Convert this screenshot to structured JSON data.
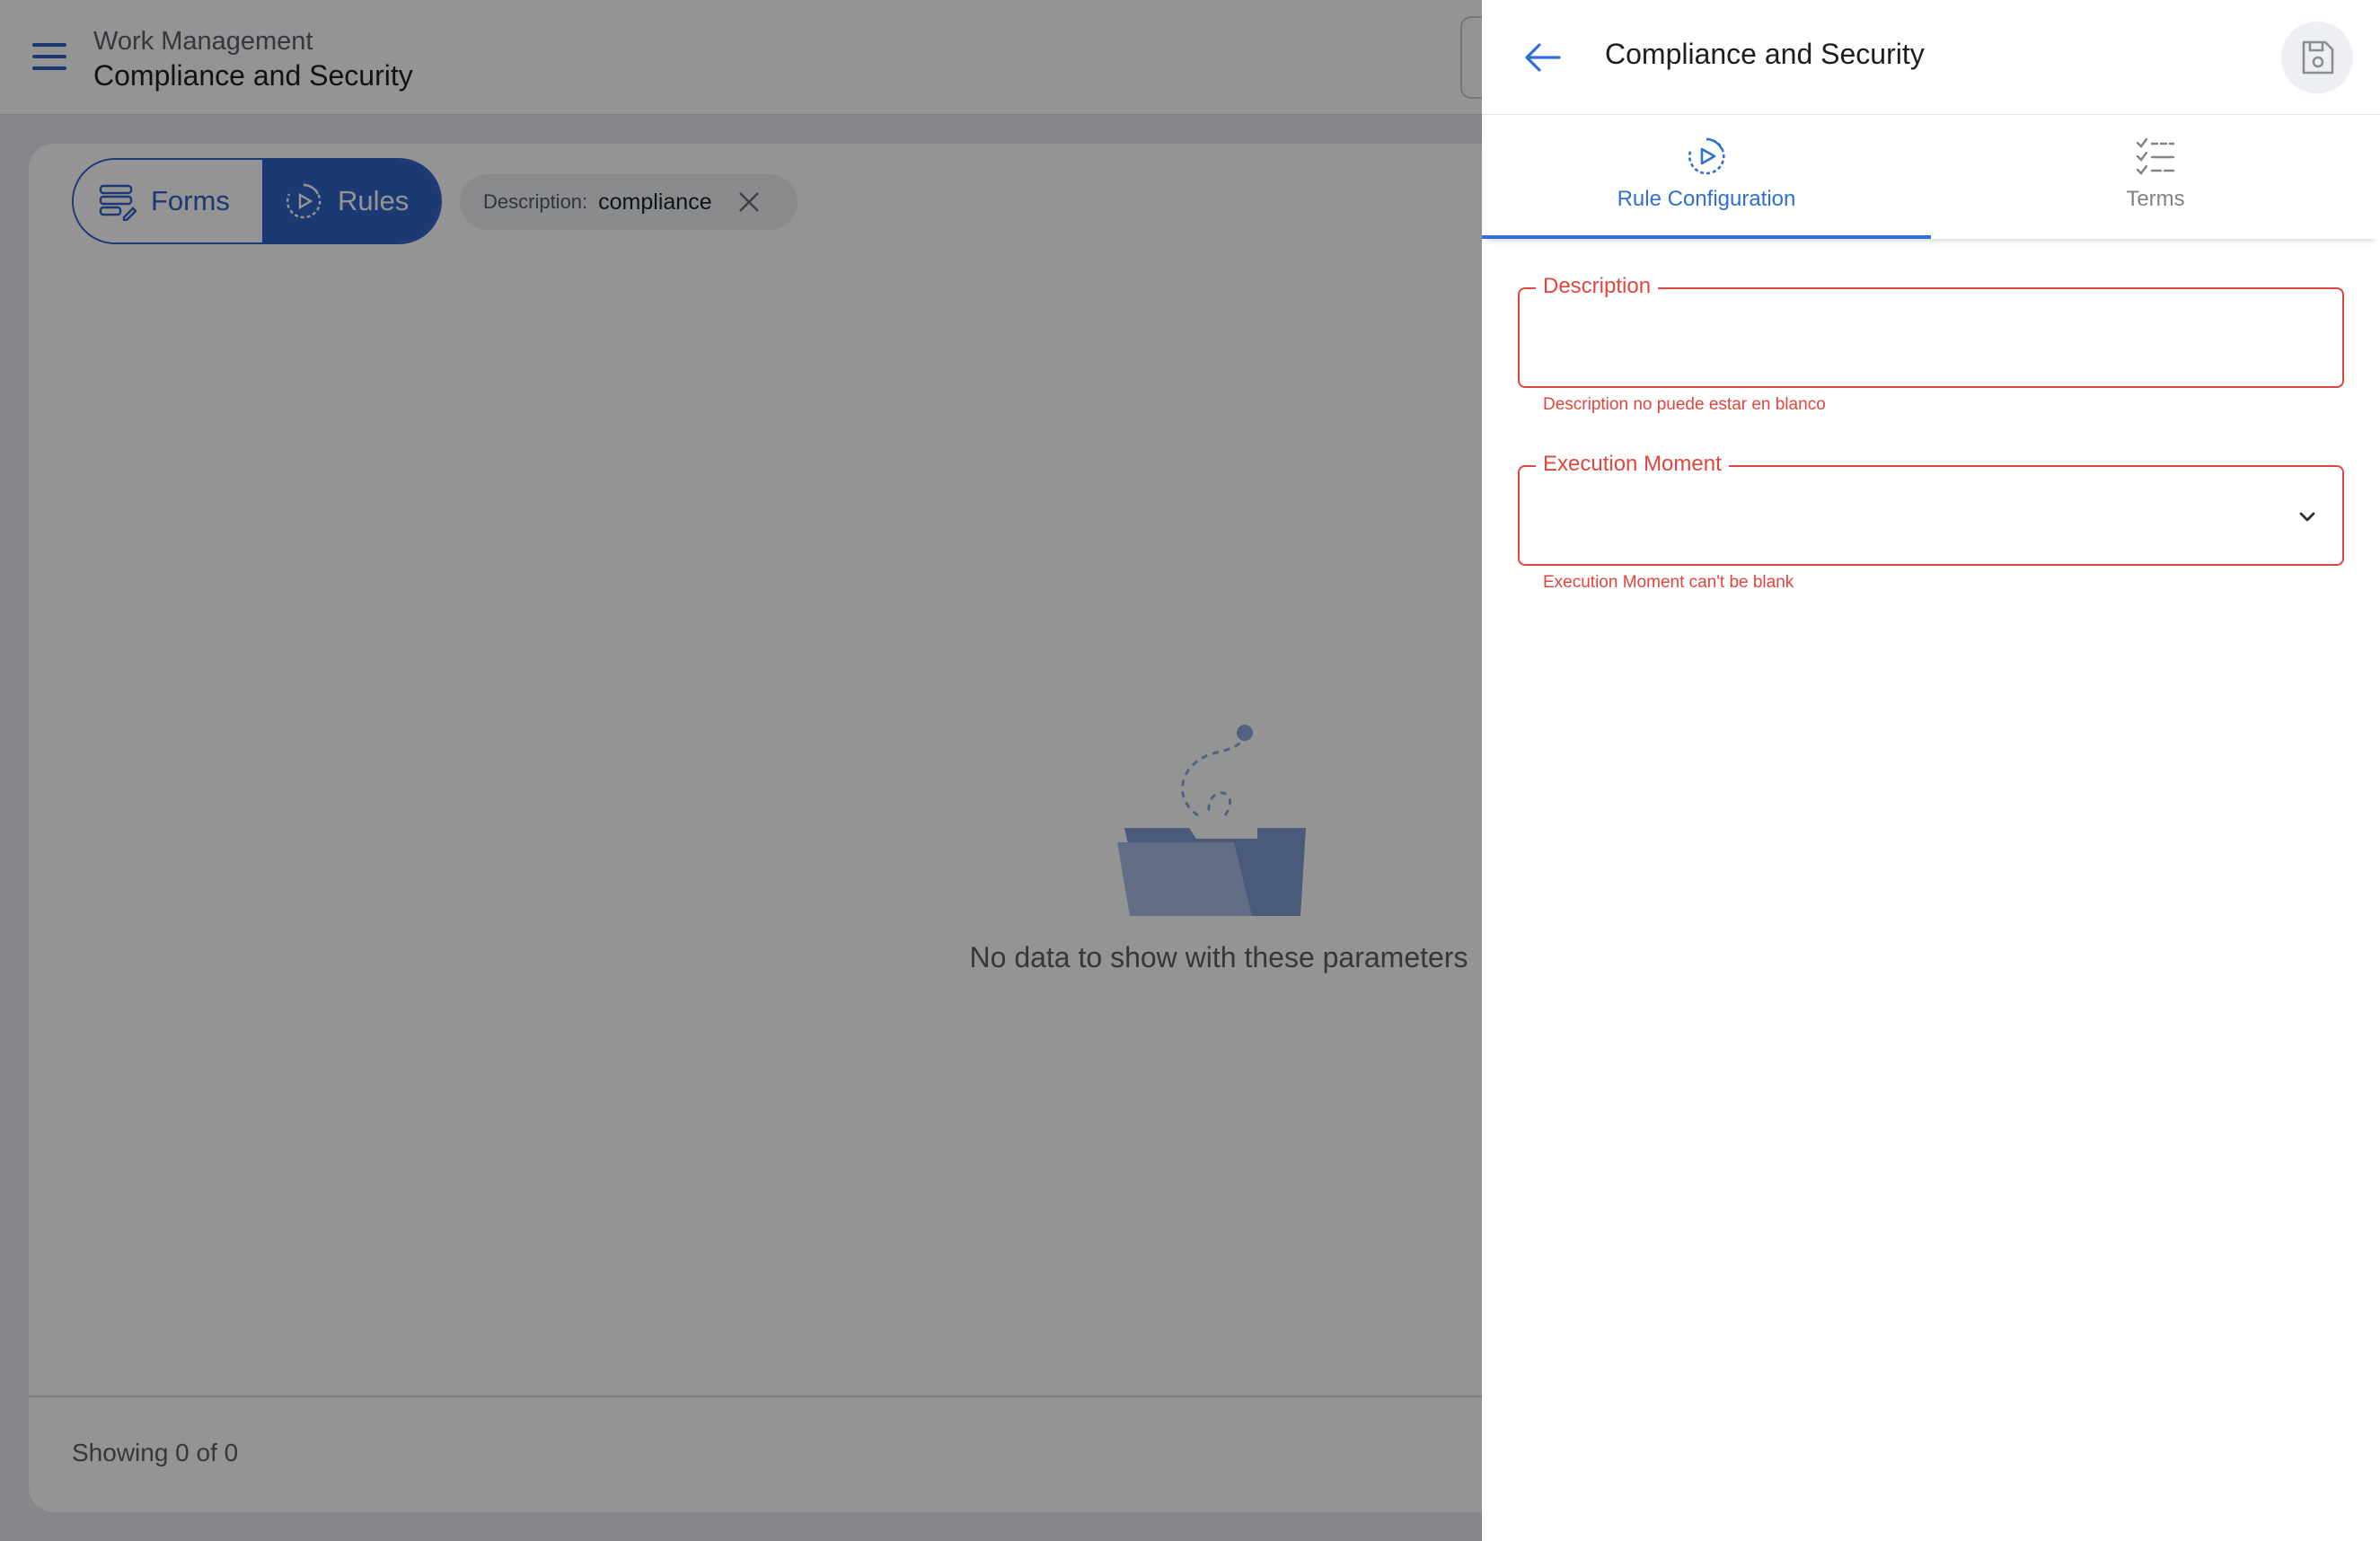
{
  "topbar": {
    "app_sub": "Work Management",
    "app_title": "Compliance and Security"
  },
  "toolbar": {
    "forms_label": "Forms",
    "rules_label": "Rules",
    "filter_chip": {
      "label": "Description:",
      "value": "compliance"
    }
  },
  "main": {
    "empty_text": "No data to show with these parameters",
    "footer_text": "Showing 0 of 0"
  },
  "drawer": {
    "title": "Compliance and Security",
    "tabs": [
      {
        "label": "Rule Configuration",
        "active": true
      },
      {
        "label": "Terms",
        "active": false
      }
    ],
    "fields": {
      "description": {
        "label": "Description",
        "value": "",
        "error": "Description no puede estar en blanco"
      },
      "execution_moment": {
        "label": "Execution Moment",
        "value": "",
        "error": "Execution Moment can't be blank"
      }
    }
  },
  "colors": {
    "primary": "#2f62c7",
    "accent_tab": "#2f6fd6",
    "error": "#e2453d",
    "illustration": "#8fa9dc"
  },
  "icons": [
    "menu-icon",
    "forms-icon",
    "rules-icon",
    "close-icon",
    "back-arrow-icon",
    "save-icon",
    "rule-config-icon",
    "terms-checklist-icon",
    "chevron-down-icon",
    "empty-folder-icon"
  ]
}
